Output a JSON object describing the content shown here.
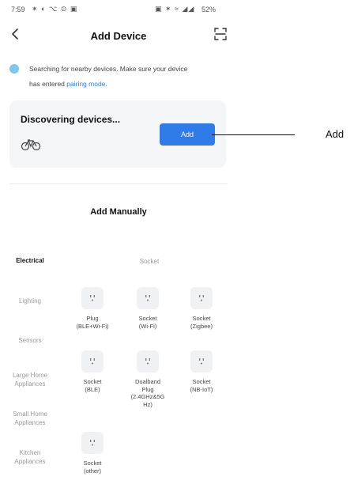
{
  "status_bar": {
    "time": "7:59",
    "left_icons": "✶ ◐ ⌥ ⊙ ▣",
    "right_icons": "▣ ✶ ≈ ◢◢",
    "battery": "52%"
  },
  "header": {
    "title": "Add Device"
  },
  "notice": {
    "line1": "Searching for nearby devices. Make sure your device",
    "line2_prefix": "has entered ",
    "line2_link": "pairing mode",
    "line2_suffix": "."
  },
  "discover": {
    "title": "Discovering devices...",
    "add_label": "Add"
  },
  "manual": {
    "title": "Add Manually",
    "subcategory": "Socket"
  },
  "categories": [
    {
      "label": "Electrical",
      "active": true
    },
    {
      "label": "Lighting"
    },
    {
      "label": "Sensors"
    },
    {
      "label": "Large Home\nAppliances"
    },
    {
      "label": "Small Home\nAppliances"
    },
    {
      "label": "Kitchen\nAppliances"
    }
  ],
  "devices": [
    {
      "label": "Plug\n(BLE+Wi-Fi)"
    },
    {
      "label": "Socket\n(Wi-Fi)"
    },
    {
      "label": "Socket\n(Zigbee)"
    },
    {
      "label": "Socket\n(BLE)"
    },
    {
      "label": "Dualband\nPlug\n(2.4GHz&5G\nHz)"
    },
    {
      "label": "Socket\n(NB-IoT)"
    },
    {
      "label": "Socket\n(other)"
    }
  ],
  "callout": {
    "label": "Add"
  },
  "colors": {
    "accent": "#2f7bea",
    "link": "#2a7ee6",
    "card_bg": "#f4f5f7"
  }
}
